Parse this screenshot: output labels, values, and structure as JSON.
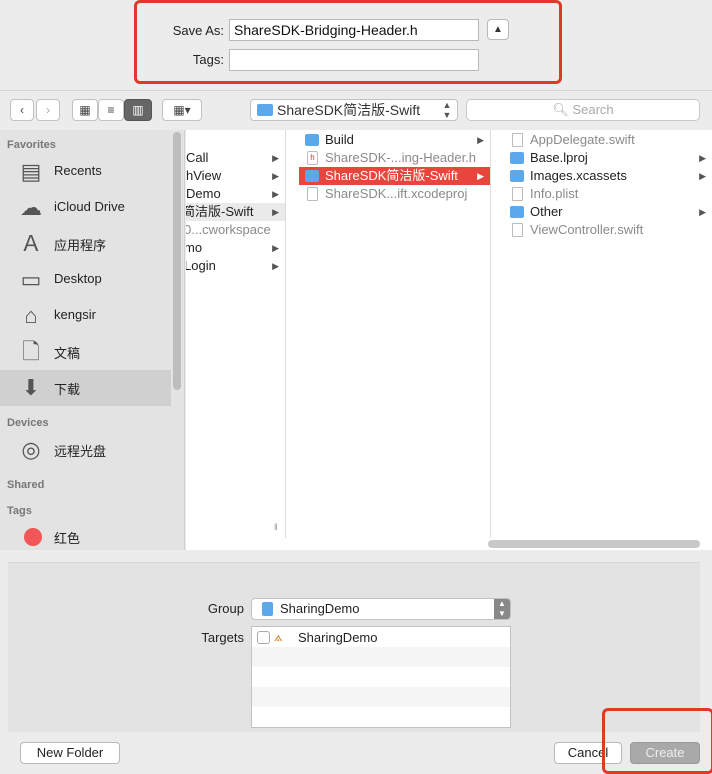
{
  "save": {
    "save_as_label": "Save As:",
    "filename": "ShareSDK-Bridging-Header.h",
    "tags_label": "Tags:",
    "tags_value": ""
  },
  "toolbar": {
    "path": "ShareSDK简洁版-Swift",
    "search_placeholder": "Search"
  },
  "sidebar": {
    "favorites_title": "Favorites",
    "favorites": [
      {
        "label": "Recents",
        "icon": "recents-icon"
      },
      {
        "label": "iCloud Drive",
        "icon": "cloud-icon"
      },
      {
        "label": "应用程序",
        "icon": "applications-icon"
      },
      {
        "label": "Desktop",
        "icon": "desktop-icon"
      },
      {
        "label": "kengsir",
        "icon": "home-icon"
      },
      {
        "label": "文稿",
        "icon": "documents-icon"
      },
      {
        "label": "下载",
        "icon": "downloads-icon"
      }
    ],
    "devices_title": "Devices",
    "devices": [
      {
        "label": "远程光盘",
        "icon": "disc-icon"
      }
    ],
    "shared_title": "Shared",
    "tags_title": "Tags",
    "tags": [
      {
        "label": "红色",
        "color": "#f25656"
      }
    ]
  },
  "columns": {
    "col1": [
      {
        "label": "Call",
        "chevron": true
      },
      {
        "label": "hView",
        "chevron": true
      },
      {
        "label": "Demo",
        "chevron": true
      },
      {
        "label": "简洁版-Swift",
        "chevron": true,
        "selected": true
      },
      {
        "label": "0...cworkspace",
        "chevron": false,
        "dim": true
      },
      {
        "label": "mo",
        "chevron": true
      },
      {
        "label": "Login",
        "chevron": true
      }
    ],
    "col2": [
      {
        "label": "Build",
        "type": "folder",
        "chevron": true
      },
      {
        "label": "ShareSDK-...ing-Header.h",
        "type": "header",
        "dim": true
      },
      {
        "label": "ShareSDK简洁版-Swift",
        "type": "folder",
        "chevron": true,
        "selected": true
      },
      {
        "label": "ShareSDK...ift.xcodeproj",
        "type": "file",
        "dim": true
      }
    ],
    "col3": [
      {
        "label": "AppDelegate.swift",
        "type": "file",
        "dim": true
      },
      {
        "label": "Base.lproj",
        "type": "folder",
        "chevron": true
      },
      {
        "label": "Images.xcassets",
        "type": "folder",
        "chevron": true
      },
      {
        "label": "Info.plist",
        "type": "file",
        "dim": true
      },
      {
        "label": "Other",
        "type": "folder",
        "chevron": true
      },
      {
        "label": "ViewController.swift",
        "type": "file",
        "dim": true
      }
    ]
  },
  "bottom": {
    "group_label": "Group",
    "group_value": "SharingDemo",
    "targets_label": "Targets",
    "targets": [
      {
        "label": "SharingDemo",
        "checked": false
      }
    ],
    "new_folder": "New Folder",
    "cancel": "Cancel",
    "create": "Create"
  },
  "colors": {
    "highlight": "#e0392b",
    "selection_red": "#e8453c",
    "folder_blue": "#5ba8ea"
  }
}
